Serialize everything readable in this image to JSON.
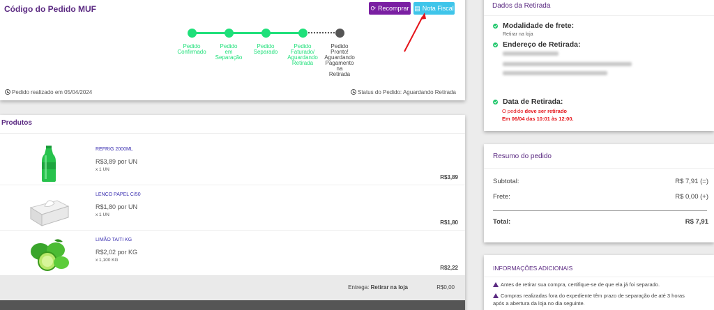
{
  "order": {
    "title": "Código do Pedido MUF",
    "rebuy_label": "Recomprar",
    "invoice_label": "Nota Fiscal",
    "steps": [
      {
        "label": "Pedido\nConfirmado"
      },
      {
        "label": "Pedido\nem\nSeparação"
      },
      {
        "label": "Pedido\nSeparado"
      },
      {
        "label": "Pedido\nFaturado/\nAguardando\nRetirada"
      },
      {
        "label": "Pedido\nPronto!\nAguardando\nPagamento\nna\nRetirada"
      }
    ],
    "date_text": "Pedido realizado em 05/04/2024",
    "status_text": "Status do Pedido: Aguardando Retirada"
  },
  "products": {
    "title": "Produtos",
    "items": [
      {
        "name": "REFRIG 2000ML",
        "unit_price": "R$3,89 por UN",
        "qty": "x 1 UN",
        "total": "R$3,89",
        "image": "soda-bottle"
      },
      {
        "name": "LENCO PAPEL C/50",
        "unit_price": "R$1,80 por UN",
        "qty": "x 1 UN",
        "total": "R$1,80",
        "image": "tissue-box"
      },
      {
        "name": "LIMÃO TAITI KG",
        "unit_price": "R$2,02 por KG",
        "qty": "x 1,100 KG",
        "total": "R$2,22",
        "image": "limes"
      }
    ],
    "delivery_label": "Entrega:",
    "delivery_value": "Retirar na loja",
    "delivery_price": "R$0,00"
  },
  "pickup": {
    "title": "Dados da Retirada",
    "mode_label": "Modalidade de frete:",
    "mode_value": "Retirar na loja",
    "address_label": "Endereço de Retirada:",
    "date_label": "Data de Retirada:",
    "notice_prefix": "O pedido",
    "notice_bold": "deve ser retirado",
    "notice_line2": "Em 06/04 das 10:01 às 12:00."
  },
  "summary": {
    "title": "Resumo do pedido",
    "subtotal_label": "Subtotal:",
    "subtotal_value": "R$ 7,91 (=)",
    "shipping_label": "Frete:",
    "shipping_value": "R$ 0,00 (+)",
    "total_label": "Total:",
    "total_value": "R$ 7,91"
  },
  "info": {
    "title": "INFORMAÇÕES ADICIONAIS",
    "items": [
      "Antes de retirar sua compra, certifique-se de que ela já foi separado.",
      "Compras realizadas fora do expediente têm prazo de separação de até 3 horas após a abertura da loja no dia seguinte."
    ]
  },
  "colors": {
    "brand": "#5b2a82",
    "progress": "#1fe07a",
    "rebuy": "#7a1fa2",
    "invoice": "#3fc5ea",
    "alert": "#e5141a"
  }
}
